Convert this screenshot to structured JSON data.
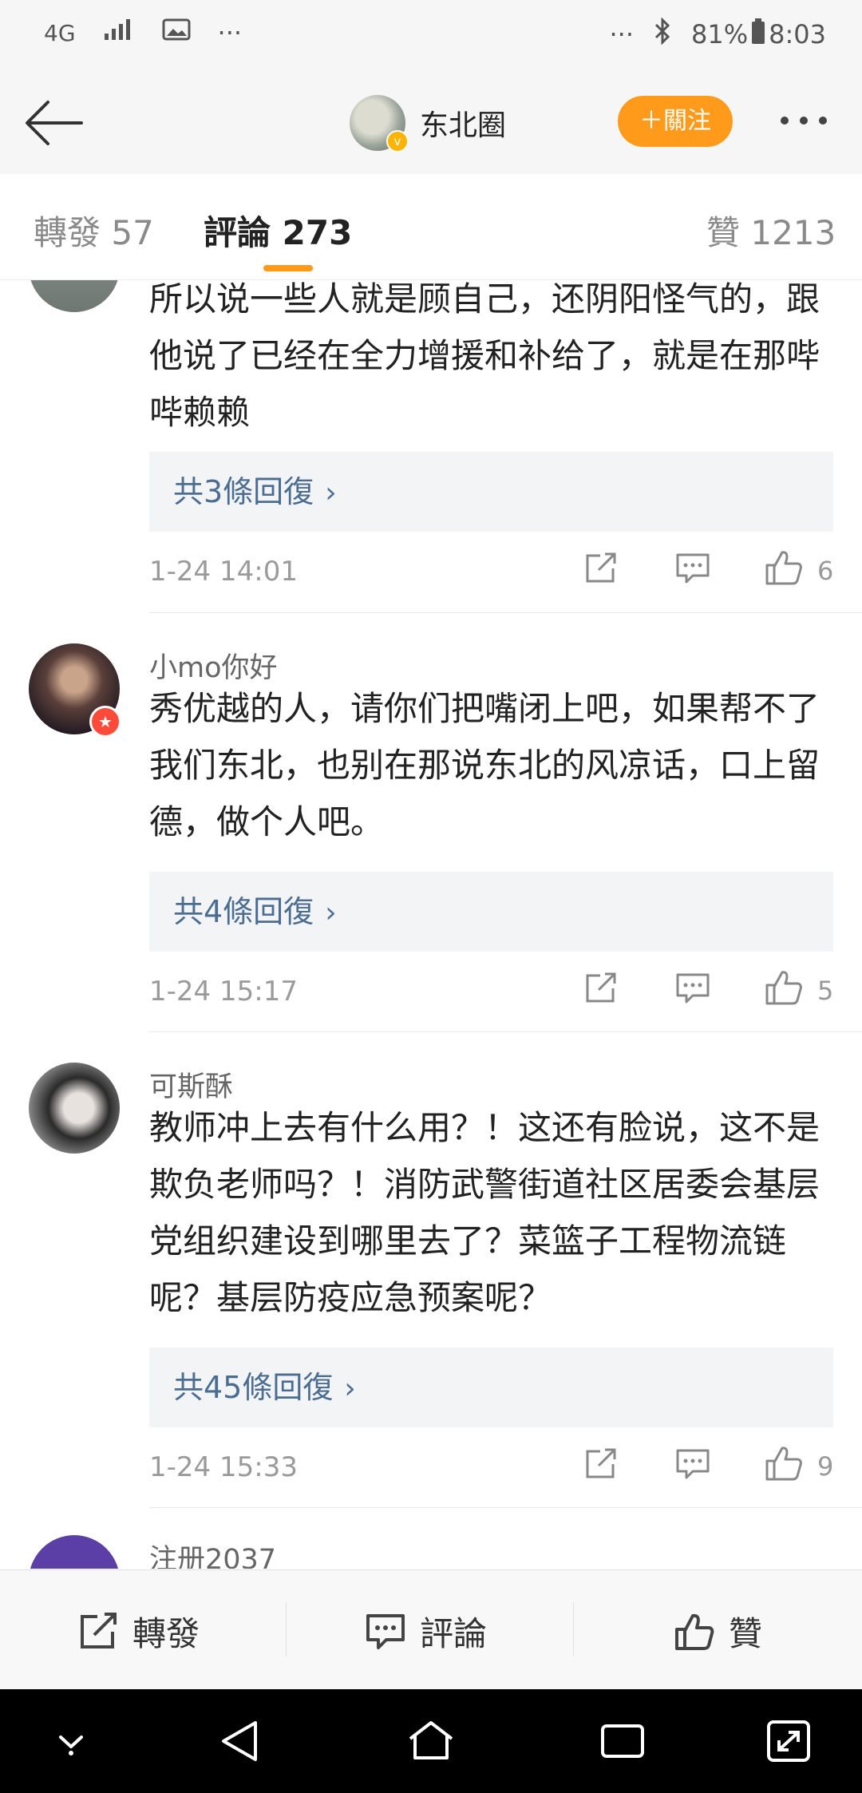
{
  "status_bar": {
    "network": "4G",
    "left_more": "···",
    "right_more": "···",
    "battery": "81%",
    "time": "8:03"
  },
  "header": {
    "title": "东北圈",
    "follow_label": "＋關注"
  },
  "tabs": [
    {
      "label": "轉發 57"
    },
    {
      "label": "評論 273"
    },
    {
      "label": "贊 1213"
    }
  ],
  "comments": [
    {
      "username": "",
      "text": "所以说一些人就是顾自己，还阴阳怪气的，跟他说了已经在全力增援和补给了，就是在那哔哔赖赖",
      "replies_label": "共3條回復",
      "time": "1-24 14:01",
      "likes": "6"
    },
    {
      "username": "小mo你好",
      "text": "秀优越的人，请你们把嘴闭上吧，如果帮不了我们东北，也别在那说东北的风凉话，口上留德，做个人吧。",
      "replies_label": "共4條回復",
      "time": "1-24 15:17",
      "likes": "5"
    },
    {
      "username": "可斯酥",
      "text": "教师冲上去有什么用？！这还有脸说，这不是欺负老师吗？！消防武警街道社区居委会基层党组织建设到哪里去了？菜篮子工程物流链呢？基层防疫应急预案呢？",
      "replies_label": "共45條回復",
      "time": "1-24 15:33",
      "likes": "9"
    },
    {
      "username": "注册2037"
    }
  ],
  "bottom_bar": {
    "repost": "轉發",
    "comment": "評論",
    "like": "贊"
  },
  "colors": {
    "accent": "#ff9a1a",
    "link": "#4b6d91"
  }
}
